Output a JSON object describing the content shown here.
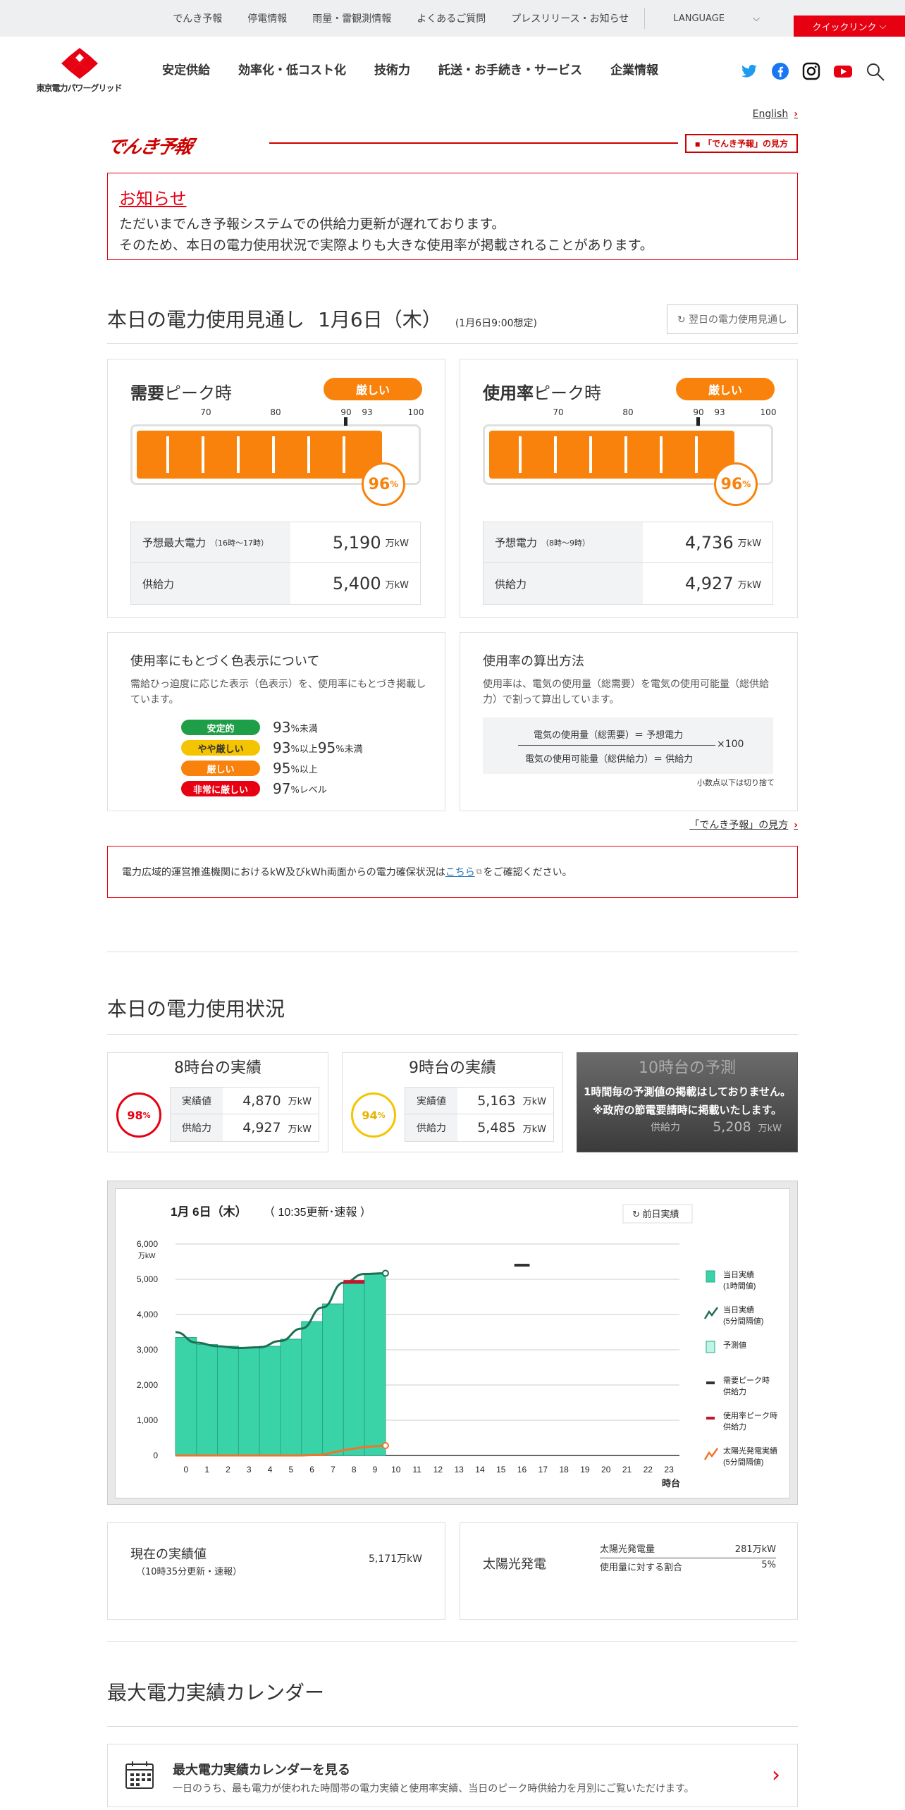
{
  "topbar": {
    "links": [
      "でんき予報",
      "停電情報",
      "雨量・雷観測情報",
      "よくあるご質問",
      "プレスリリース・お知らせ"
    ],
    "language": "LANGUAGE",
    "quick": "クイックリンク"
  },
  "header": {
    "logo_text": "東京電力パワーグリッド",
    "nav": [
      "安定供給",
      "効率化・低コスト化",
      "技術力",
      "託送・お手続き・サービス",
      "企業情報"
    ]
  },
  "english": "English",
  "logo_link": "「でんき予報」の見方",
  "brand": "でんき予報",
  "notice": {
    "title": "お知らせ",
    "lines": [
      "ただいまでんき予報システムでの供給力更新が遅れております。",
      "そのため、本日の電力使用状況で実際よりも大きな使用率が掲載されることがあります。"
    ]
  },
  "today": {
    "title": "本日の電力使用見通し",
    "date": "1月6日（木）",
    "sub": "(1月6日9:00想定)",
    "prev": "翌日の電力使用見通し"
  },
  "scale": [
    "70",
    "80",
    "90",
    "93",
    "100"
  ],
  "demand": {
    "title_b": "需要",
    "title": "ピーク時",
    "badge": "厳しい",
    "pct": "96",
    "pct_unit": "%",
    "fill": 0.96,
    "r1_label": "予想最大電力",
    "r1_note": "（16時～17時）",
    "r1_val": "5,190",
    "r2_label": "供給力",
    "r2_val": "5,400",
    "unit": "万kW"
  },
  "usage": {
    "title_b": "使用率",
    "title": "ピーク時",
    "badge": "厳しい",
    "pct": "96",
    "pct_unit": "%",
    "fill": 0.96,
    "r1_label": "予想電力",
    "r1_note": "（8時～9時）",
    "r1_val": "4,736",
    "r2_label": "供給力",
    "r2_val": "4,927",
    "unit": "万kW"
  },
  "color_info": {
    "title": "使用率にもとづく色表示について",
    "desc": "需給ひっ迫度に応じた表示（色表示）を、使用率にもとづき掲載しています。",
    "items": [
      {
        "label": "安定的",
        "n1": "93",
        "u1": "%未満",
        "n2": "",
        "u2": "",
        "color": "#1e9e46"
      },
      {
        "label": "やや厳しい",
        "n1": "93",
        "u1": "%以上",
        "n2": "95",
        "u2": "%未満",
        "color": "#f5c400"
      },
      {
        "label": "厳しい",
        "n1": "95",
        "u1": "%以上",
        "n2": "",
        "u2": "",
        "color": "#f8820b"
      },
      {
        "label": "非常に厳しい",
        "n1": "97",
        "u1": "%レベル",
        "n2": "",
        "u2": "",
        "color": "#e60012"
      }
    ]
  },
  "calc": {
    "title": "使用率の算出方法",
    "desc": "使用率は、電気の使用量（総需要）を電気の使用可能量（総供給力）で割って算出しています。",
    "top": "電気の使用量（総需要）＝ 予想電力",
    "bot": "電気の使用可能量（総供給力）＝ 供給力",
    "x": "×100",
    "note": "小数点以下は切り捨て"
  },
  "howto": "「でんき予報」の見方",
  "kwh": {
    "pre": "電力広域的運営推進機関におけるkW及びkWh両面からの電力確保状況は",
    "link": "こちら",
    "post": " をご確認ください。"
  },
  "now": {
    "title": "本日の電力使用状況"
  },
  "mini": [
    {
      "title": "8時台の実績",
      "pct": "98",
      "color": "#e60012",
      "actual_label": "実績値",
      "actual": "4,870",
      "supply_label": "供給力",
      "supply": "4,927",
      "unit": "万kW"
    },
    {
      "title": "9時台の実績",
      "pct": "94",
      "color": "#f5c400",
      "actual_label": "実績値",
      "actual": "5,163",
      "supply_label": "供給力",
      "supply": "5,485",
      "unit": "万kW"
    },
    {
      "title": "10時台の予測",
      "overlay1": "1時間毎の予測値の掲載はしておりません。",
      "overlay2": "※政府の節電要請時に掲載いたします。",
      "supply_label": "供給力",
      "supply": "5,208",
      "unit": "万kW"
    }
  ],
  "chart_data": {
    "type": "bar",
    "title": "1月 6日（木）",
    "subtitle": "（ 10:35更新･速報 ）",
    "prev_button": "前日実績",
    "y_unit": "万kW",
    "ylim": [
      0,
      6000
    ],
    "yticks": [
      "0",
      "1,000",
      "2,000",
      "3,000",
      "4,000",
      "5,000",
      "6,000"
    ],
    "xlabel": "時台",
    "categories": [
      "0",
      "1",
      "2",
      "3",
      "4",
      "5",
      "6",
      "7",
      "8",
      "9",
      "10",
      "11",
      "12",
      "13",
      "14",
      "15",
      "16",
      "17",
      "18",
      "19",
      "20",
      "21",
      "22",
      "23"
    ],
    "series": [
      {
        "name": "当日実績（1時間値）",
        "values": [
          3350,
          3150,
          3100,
          3050,
          3100,
          3300,
          3800,
          4300,
          4870,
          5163
        ]
      },
      {
        "name": "当日実績（5分間隔値）",
        "values": [
          3500,
          3200,
          3100,
          3050,
          3070,
          3250,
          3600,
          4200,
          4900,
          5150,
          5171
        ]
      },
      {
        "name": "太陽光発電実績（5分間隔値）",
        "values": [
          0,
          0,
          0,
          0,
          0,
          0,
          0,
          20,
          150,
          240,
          281
        ]
      }
    ],
    "demand_peak_supply": {
      "x": 16,
      "value": 5400
    },
    "usage_peak_supply": {
      "x": 8,
      "value": 4927
    },
    "legend": [
      "当日実績\n(1時間値)",
      "当日実績\n(5分間隔値)",
      "予測値",
      "需要ピーク時\n供給力",
      "使用率ピーク時\n供給力",
      "太陽光発電実績\n(5分間隔値)"
    ]
  },
  "current": {
    "title": "現在の実績値",
    "sub": "（10時35分更新・速報）",
    "val": "5,171万kW"
  },
  "solar": {
    "title": "太陽光発電",
    "r1l": "太陽光発電量",
    "r1v": "281万kW",
    "r2l": "使用量に対する割合",
    "r2v": "5%"
  },
  "calendar": {
    "title": "最大電力実績カレンダー",
    "link": "最大電力実績カレンダーを見る",
    "desc": "一日のうち、最も電力が使われた時間帯の電力実績と使用率実績、当日のピーク時供給力を月別にご覧いただけます。"
  }
}
